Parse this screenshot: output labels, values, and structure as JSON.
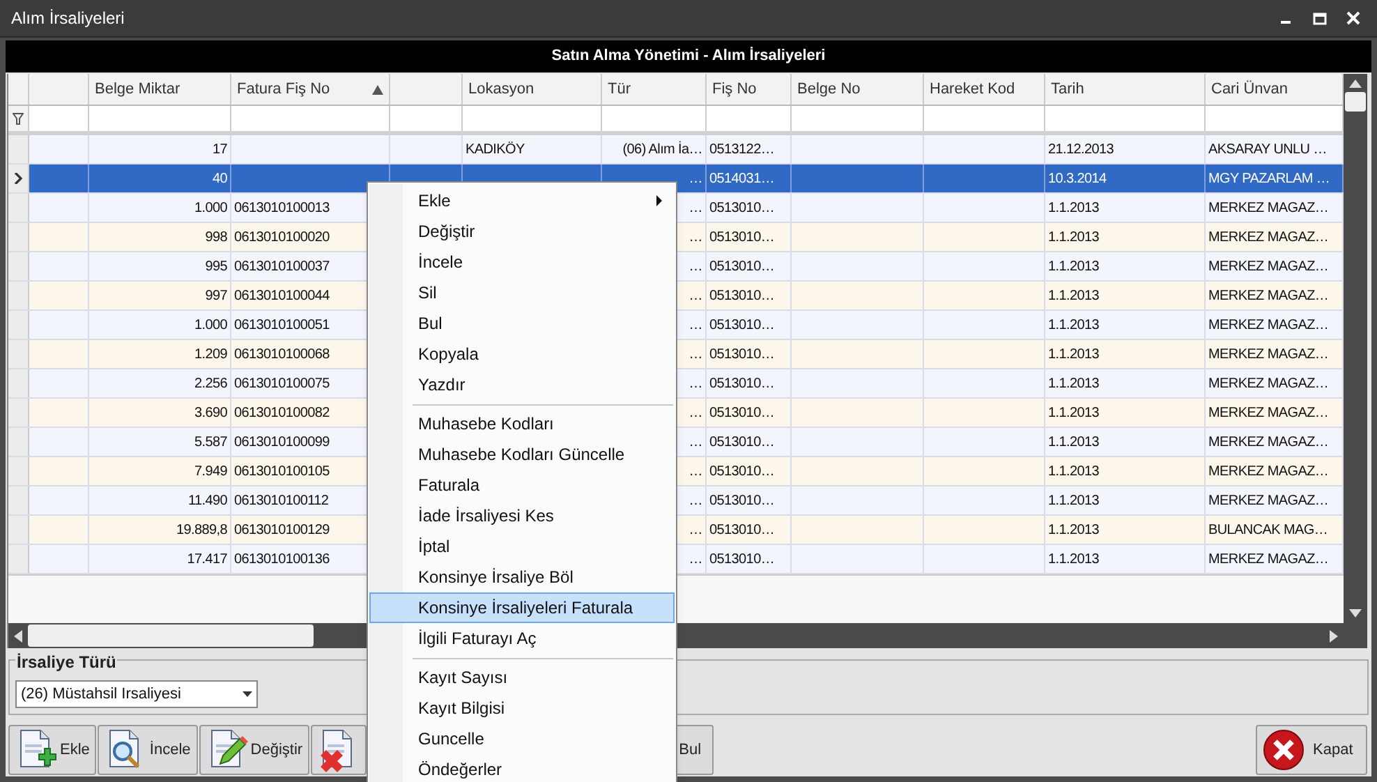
{
  "window": {
    "title": "Alım İrsaliyeleri"
  },
  "banner": "Satın Alma Yönetimi - Alım İrsaliyeleri",
  "grid": {
    "columns": [
      {
        "kind": "blank"
      },
      {
        "kind": "number",
        "label": "Belge Miktar"
      },
      {
        "kind": "text",
        "label": "Fatura Fiş No",
        "sorted": true
      },
      {
        "kind": "blank"
      },
      {
        "kind": "text",
        "label": "Lokasyon"
      },
      {
        "kind": "text",
        "label": "Tür"
      },
      {
        "kind": "text",
        "label": "Fiş No"
      },
      {
        "kind": "text",
        "label": "Belge No"
      },
      {
        "kind": "text",
        "label": "Hareket Kod"
      },
      {
        "kind": "text",
        "label": "Tarih"
      },
      {
        "kind": "text",
        "label": "Cari Ünvan"
      }
    ],
    "rows": [
      {
        "selected": false,
        "cells": [
          null,
          "17",
          null,
          null,
          "KADIKÖY",
          "(06) Alım İa…",
          "0513122…",
          null,
          null,
          "21.12.2013",
          "AKSARAY UNLU …"
        ]
      },
      {
        "selected": true,
        "cells": [
          null,
          "40",
          null,
          null,
          null,
          "…",
          "0514031…",
          null,
          null,
          "10.3.2014",
          "MGY PAZARLAM …"
        ]
      },
      {
        "selected": false,
        "cells": [
          null,
          "1.000",
          "0613010100013",
          null,
          null,
          "…",
          "0513010…",
          null,
          null,
          "1.1.2013",
          "MERKEZ MAGAZ…"
        ]
      },
      {
        "selected": false,
        "cells": [
          null,
          "998",
          "0613010100020",
          null,
          null,
          "…",
          "0513010…",
          null,
          null,
          "1.1.2013",
          "MERKEZ MAGAZ…"
        ]
      },
      {
        "selected": false,
        "cells": [
          null,
          "995",
          "0613010100037",
          null,
          null,
          "…",
          "0513010…",
          null,
          null,
          "1.1.2013",
          "MERKEZ MAGAZ…"
        ]
      },
      {
        "selected": false,
        "cells": [
          null,
          "997",
          "0613010100044",
          null,
          null,
          "…",
          "0513010…",
          null,
          null,
          "1.1.2013",
          "MERKEZ MAGAZ…"
        ]
      },
      {
        "selected": false,
        "cells": [
          null,
          "1.000",
          "0613010100051",
          null,
          null,
          "…",
          "0513010…",
          null,
          null,
          "1.1.2013",
          "MERKEZ MAGAZ…"
        ]
      },
      {
        "selected": false,
        "cells": [
          null,
          "1.209",
          "0613010100068",
          null,
          null,
          "…",
          "0513010…",
          null,
          null,
          "1.1.2013",
          "MERKEZ MAGAZ…"
        ]
      },
      {
        "selected": false,
        "cells": [
          null,
          "2.256",
          "0613010100075",
          null,
          null,
          "…",
          "0513010…",
          null,
          null,
          "1.1.2013",
          "MERKEZ MAGAZ…"
        ]
      },
      {
        "selected": false,
        "cells": [
          null,
          "3.690",
          "0613010100082",
          null,
          null,
          "…",
          "0513010…",
          null,
          null,
          "1.1.2013",
          "MERKEZ MAGAZ…"
        ]
      },
      {
        "selected": false,
        "cells": [
          null,
          "5.587",
          "0613010100099",
          null,
          null,
          "…",
          "0513010…",
          null,
          null,
          "1.1.2013",
          "MERKEZ MAGAZ…"
        ]
      },
      {
        "selected": false,
        "cells": [
          null,
          "7.949",
          "0613010100105",
          null,
          null,
          "…",
          "0513010…",
          null,
          null,
          "1.1.2013",
          "MERKEZ MAGAZ…"
        ]
      },
      {
        "selected": false,
        "cells": [
          null,
          "11.490",
          "0613010100112",
          null,
          null,
          "…",
          "0513010…",
          null,
          null,
          "1.1.2013",
          "MERKEZ MAGAZ…"
        ]
      },
      {
        "selected": false,
        "cells": [
          null,
          "19.889,8",
          "0613010100129",
          null,
          null,
          "…",
          "0513010…",
          null,
          null,
          "1.1.2013",
          "BULANCAK MAG…"
        ]
      },
      {
        "selected": false,
        "cells": [
          null,
          "17.417",
          "0613010100136",
          null,
          null,
          "…",
          "0513010…",
          null,
          null,
          "1.1.2013",
          "MERKEZ MAGAZ…"
        ]
      }
    ]
  },
  "filter": {
    "label": "İrsaliye Türü",
    "value": "(26) Müstahsil Irsaliyesi"
  },
  "buttons": [
    {
      "kind": "add",
      "label": "Ekle"
    },
    {
      "kind": "view",
      "label": "İncele"
    },
    {
      "kind": "edit",
      "label": "Değiştir"
    },
    {
      "kind": "delete"
    }
  ],
  "hidden_button": {
    "label": "Bul"
  },
  "close_button": {
    "label": "Kapat"
  },
  "context_menu": [
    {
      "kind": "item",
      "label": "Ekle",
      "submenu": true,
      "selected": false
    },
    {
      "kind": "item",
      "label": "Değiştir",
      "submenu": false,
      "selected": false
    },
    {
      "kind": "item",
      "label": "İncele",
      "submenu": false,
      "selected": false
    },
    {
      "kind": "item",
      "label": "Sil",
      "submenu": false,
      "selected": false
    },
    {
      "kind": "item",
      "label": "Bul",
      "submenu": false,
      "selected": false
    },
    {
      "kind": "item",
      "label": "Kopyala",
      "submenu": false,
      "selected": false
    },
    {
      "kind": "item",
      "label": "Yazdır",
      "submenu": false,
      "selected": false
    },
    {
      "kind": "separator"
    },
    {
      "kind": "item",
      "label": "Muhasebe Kodları",
      "submenu": false,
      "selected": false
    },
    {
      "kind": "item",
      "label": "Muhasebe Kodları Güncelle",
      "submenu": false,
      "selected": false
    },
    {
      "kind": "item",
      "label": "Faturala",
      "submenu": false,
      "selected": false
    },
    {
      "kind": "item",
      "label": "İade İrsaliyesi Kes",
      "submenu": false,
      "selected": false
    },
    {
      "kind": "item",
      "label": "İptal",
      "submenu": false,
      "selected": false
    },
    {
      "kind": "item",
      "label": "Konsinye İrsaliye Böl",
      "submenu": false,
      "selected": false
    },
    {
      "kind": "item",
      "label": "Konsinye İrsaliyeleri Faturala",
      "submenu": false,
      "selected": true
    },
    {
      "kind": "item",
      "label": "İlgili Faturayı Aç",
      "submenu": false,
      "selected": false
    },
    {
      "kind": "separator"
    },
    {
      "kind": "item",
      "label": "Kayıt Sayısı",
      "submenu": false,
      "selected": false
    },
    {
      "kind": "item",
      "label": "Kayıt Bilgisi",
      "submenu": false,
      "selected": false
    },
    {
      "kind": "item",
      "label": "Guncelle",
      "submenu": false,
      "selected": false
    },
    {
      "kind": "item",
      "label": "Öndeğerler",
      "submenu": false,
      "selected": false
    }
  ]
}
